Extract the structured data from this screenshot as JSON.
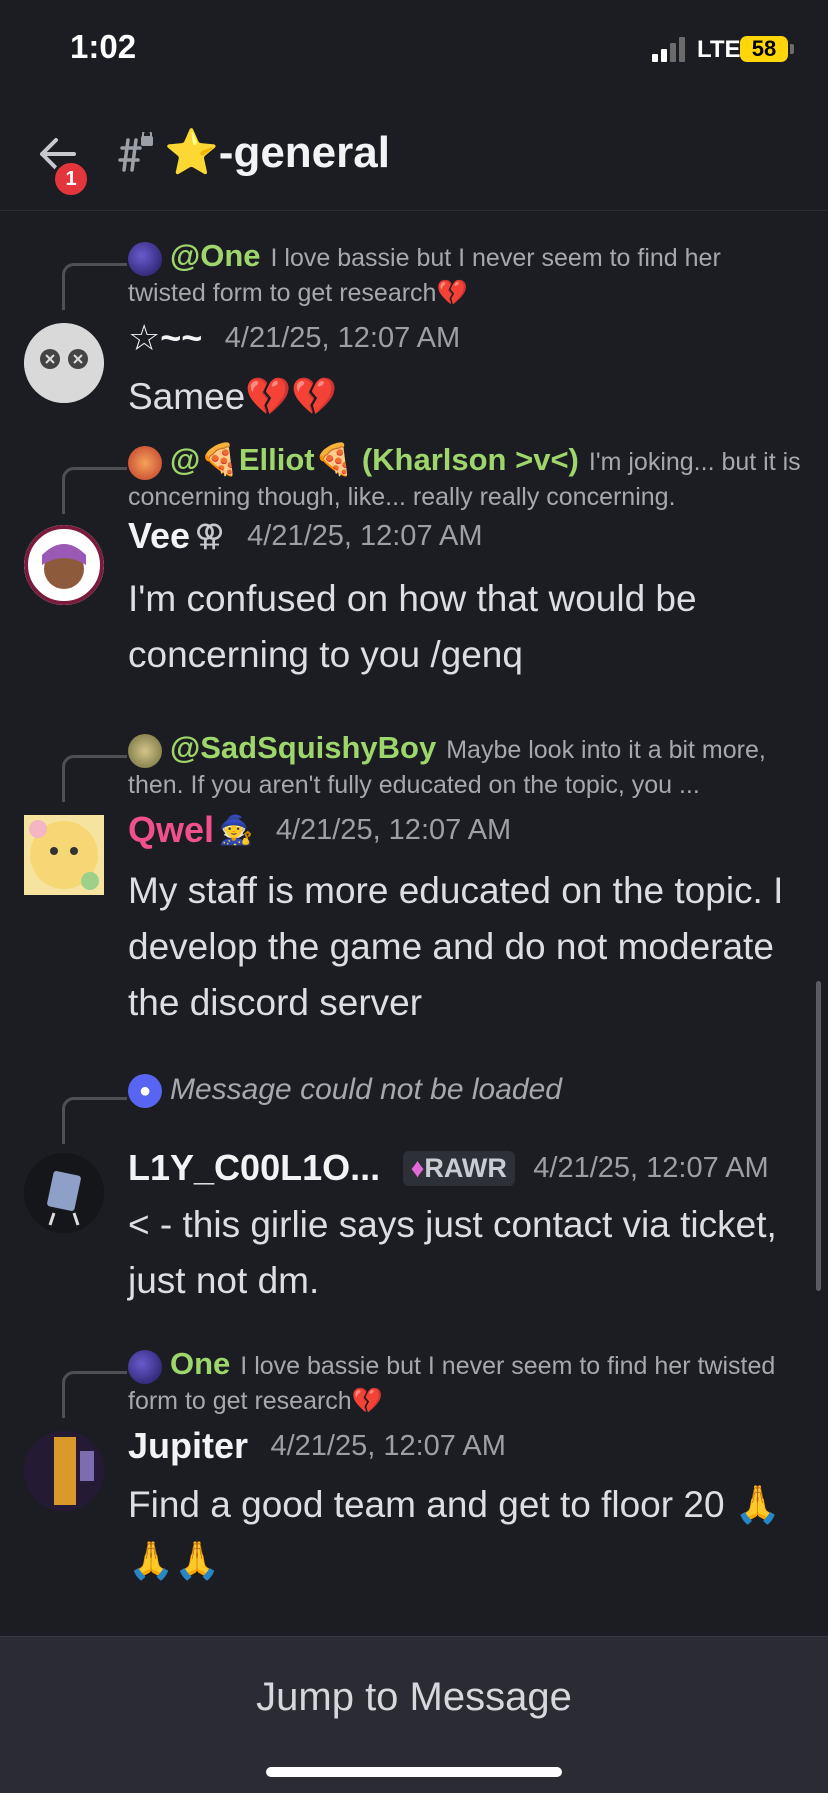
{
  "status": {
    "time": "1:02",
    "network": "LTE",
    "battery": "58"
  },
  "header": {
    "channel_title": "⭐-general",
    "back_badge": "1",
    "back_icon": "arrow-left-icon",
    "hash_icon": "locked-hash-icon"
  },
  "messages": [
    {
      "reply": {
        "mention": "@One",
        "text": "I love bassie but I never seem to find her twisted form to get research💔"
      },
      "author": "☆~~",
      "author_color": "#f2f3f5",
      "timestamp": "4/21/25, 12:07 AM",
      "body": "Samee💔💔"
    },
    {
      "reply": {
        "mention": "@🍕Elliot🍕 (Kharlson >v<)",
        "text": "I'm joking... but it is concerning though, like... really really concerning."
      },
      "author": "Vee",
      "author_suffix": "⚢",
      "author_color": "#f2f3f5",
      "timestamp": "4/21/25, 12:07 AM",
      "body": "I'm confused on how that would be concerning to you /genq"
    },
    {
      "reply": {
        "mention": "@SadSquishyBoy",
        "text": "Maybe look into it a bit more, then. If you aren't fully educated on the topic, you ..."
      },
      "author": "Qwel",
      "author_suffix": "🧙",
      "author_color": "#f0508c",
      "timestamp": "4/21/25, 12:07 AM",
      "body": "My staff is more educated on the topic. I develop the game and do not moderate the discord server"
    },
    {
      "reply": {
        "mention": "",
        "text": "Message could not be loaded"
      },
      "author": "L1Y_C00L1O...",
      "author_color": "#f2f3f5",
      "role_tag": "RAWR",
      "timestamp": "4/21/25, 12:07 AM",
      "body": "< - this girlie says just contact via ticket, just not dm."
    },
    {
      "reply": {
        "mention": "One",
        "text": "I love bassie but I never seem to find her twisted form to get research💔"
      },
      "author": "Jupiter",
      "author_color": "#f2f3f5",
      "timestamp": "4/21/25, 12:07 AM",
      "body": "Find a good team and get to floor 20 🙏🙏🙏"
    }
  ],
  "footer": {
    "jump_label": "Jump to Message"
  },
  "colors": {
    "background": "#1c1d22",
    "mention": "#9ed66b",
    "qwel": "#f0508c",
    "badge": "#e2363c"
  }
}
